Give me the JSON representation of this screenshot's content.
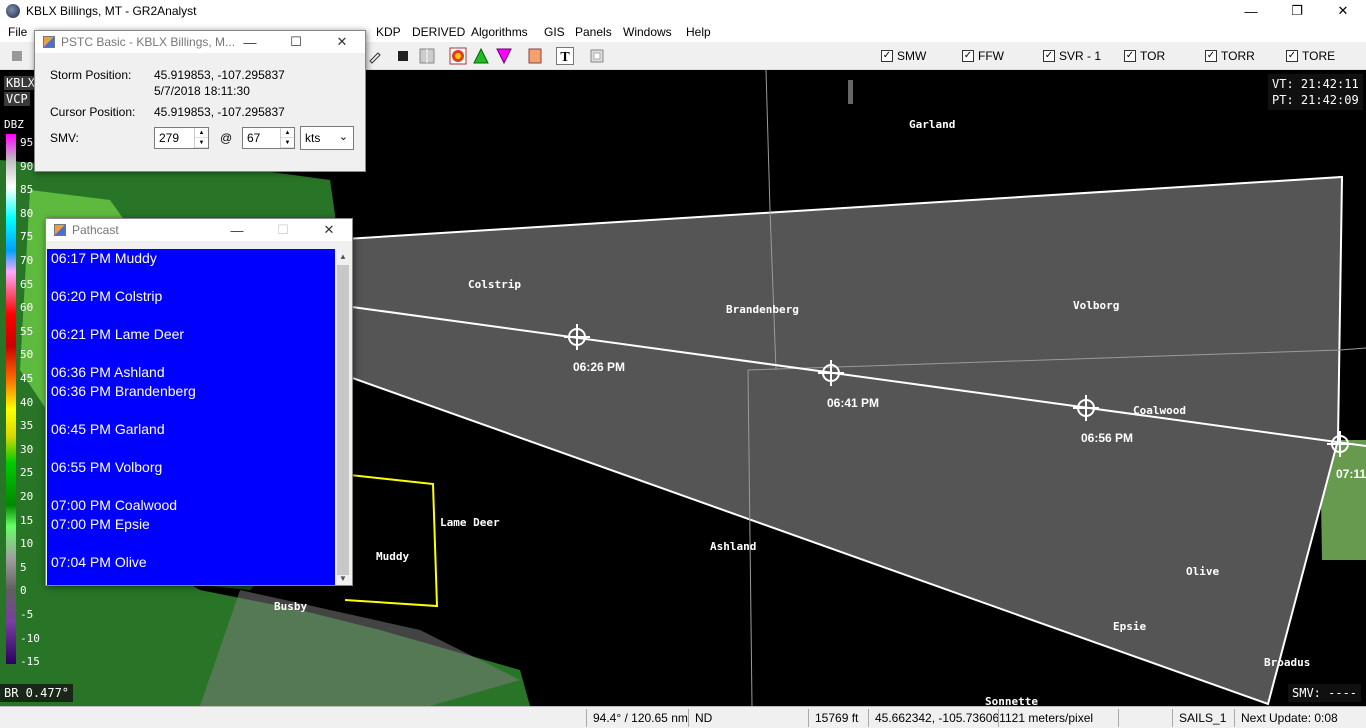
{
  "window": {
    "title": "KBLX Billings, MT - GR2Analyst"
  },
  "menu": [
    "File",
    "KDP",
    "DERIVED",
    "Algorithms",
    "GIS",
    "Panels",
    "Windows",
    "Help"
  ],
  "warnings": [
    "SMW",
    "FFW",
    "SVR - 1",
    "TOR",
    "TORR",
    "TORE"
  ],
  "scale": {
    "radar": "KBLX",
    "vcp": "VCP",
    "units": "DBZ",
    "ticks": [
      "95",
      "90",
      "85",
      "80",
      "75",
      "70",
      "65",
      "60",
      "55",
      "50",
      "45",
      "40",
      "35",
      "30",
      "25",
      "20",
      "15",
      "10",
      "5",
      "0",
      "-5",
      "-10",
      "-15"
    ],
    "product": "BR 0.477°"
  },
  "hud": {
    "vt": "VT: 21:42:11",
    "pt": "PT: 21:42:09",
    "smv": "SMV: ----"
  },
  "places": {
    "garland": "Garland",
    "colstrip": "Colstrip",
    "brandenberg": "Brandenberg",
    "volborg": "Volborg",
    "coalwood": "Coalwood",
    "lame_deer": "Lame Deer",
    "muddy": "Muddy",
    "ashland": "Ashland",
    "olive": "Olive",
    "epsie": "Epsie",
    "busby": "Busby",
    "broadus": "Broadus",
    "sonnette": "Sonnette"
  },
  "track_times": [
    "06:26 PM",
    "06:41 PM",
    "06:56 PM",
    "07:11"
  ],
  "pstc": {
    "title": "PSTC Basic - KBLX Billings, M...",
    "storm_position_label": "Storm Position:",
    "storm_position": "45.919853, -107.295837",
    "storm_time": "5/7/2018 18:11:30",
    "cursor_position_label": "Cursor Position:",
    "cursor_position": "45.919853, -107.295837",
    "smv_label": "SMV:",
    "direction": "279",
    "at": "@",
    "speed": "67",
    "units": "kts"
  },
  "pathcast": {
    "title": "Pathcast",
    "entries": [
      "06:17 PM Muddy",
      "06:20 PM Colstrip",
      "06:21 PM Lame Deer",
      "06:36 PM Ashland",
      "06:36 PM Brandenberg",
      "06:45 PM Garland",
      "06:55 PM Volborg",
      "07:00 PM Coalwood",
      "07:00 PM Epsie",
      "07:04 PM Olive"
    ]
  },
  "status": {
    "azimuth_range": "94.4° / 120.65 nm",
    "value": "ND",
    "height": "15769 ft",
    "latlon": "45.662342, -105.736061",
    "resolution": "121 meters/pixel",
    "sails": "SAILS_1",
    "next_update": "Next Update: 0:08"
  },
  "colors": {
    "polygon_fill": "#555555",
    "county_line": "#ffff00",
    "pathcast_bg": "#0000ff"
  }
}
